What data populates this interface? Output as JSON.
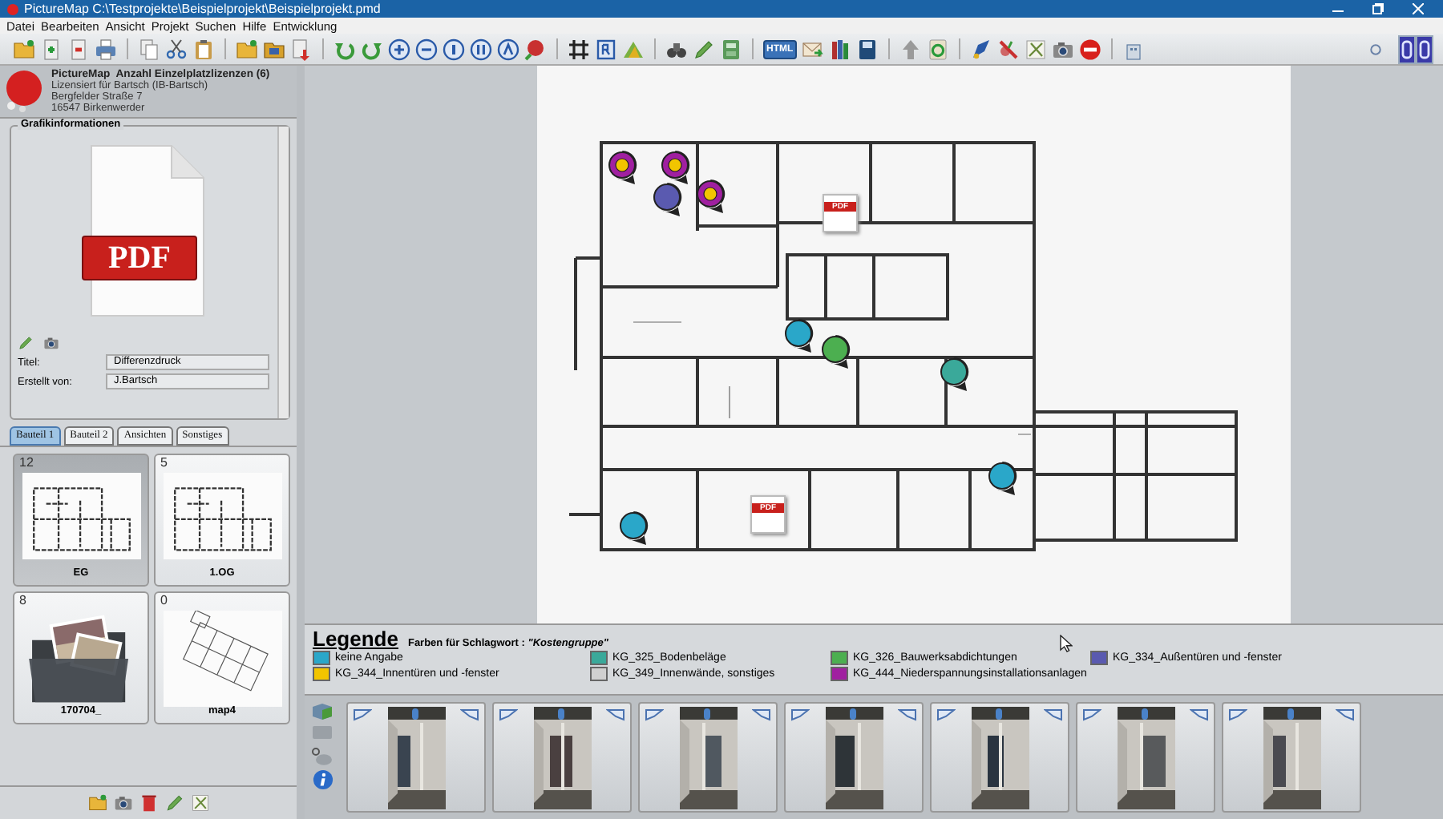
{
  "window": {
    "title": "PictureMap  C:\\Testprojekte\\Beispielprojekt\\Beispielprojekt.pmd"
  },
  "menu": [
    {
      "label": "Datei"
    },
    {
      "label": "Bearbeiten"
    },
    {
      "label": "Ansicht"
    },
    {
      "label": "Projekt"
    },
    {
      "label": "Suchen"
    },
    {
      "label": "Hilfe"
    },
    {
      "label": "Entwicklung"
    }
  ],
  "toolbar": {
    "html_button": "HTML"
  },
  "license": {
    "app": "PictureMap",
    "count": "Anzahl Einzelplatzlizenzen (6)",
    "lines": [
      "Lizensiert für Bartsch (IB-Bartsch)",
      "Bergfelder Straße  7",
      "16547  Birkenwerder"
    ]
  },
  "graphic_info": {
    "title": "Grafikinformationen",
    "document_label": "PDF",
    "fields": [
      {
        "label": "Titel:",
        "value": "Differenzdruck"
      },
      {
        "label": "Erstellt von:",
        "value": "J.Bartsch"
      }
    ]
  },
  "tabs": [
    {
      "label": "Bauteil 1",
      "selected": true
    },
    {
      "label": "Bauteil 2",
      "selected": false
    },
    {
      "label": "Ansichten",
      "selected": false
    },
    {
      "label": "Sonstiges",
      "selected": false
    }
  ],
  "plans": [
    {
      "count": "12",
      "name": "EG",
      "kind": "plan",
      "selected": true
    },
    {
      "count": "5",
      "name": "1.OG",
      "kind": "plan",
      "selected": false
    },
    {
      "count": "8",
      "name": "170704_",
      "kind": "folder",
      "selected": false
    },
    {
      "count": "0",
      "name": "map4",
      "kind": "map",
      "selected": false
    }
  ],
  "floor_plan": {
    "documents": [
      {
        "label": "PDF"
      },
      {
        "label": "PDF"
      }
    ],
    "markers": [
      {
        "color": "#a020a0",
        "center": {
          "color": "#f2c500"
        }
      },
      {
        "color": "#a020a0",
        "center": {
          "color": "#f2c500"
        }
      },
      {
        "color": "#5a5ab0"
      },
      {
        "color": "#a020a0",
        "center": {
          "color": "#f2c500"
        }
      },
      {
        "color": "#2aa7c9"
      },
      {
        "color": "#4caf50"
      },
      {
        "color": "#3aa99a"
      },
      {
        "color": "#2aa7c9"
      },
      {
        "color": "#2aa7c9"
      }
    ]
  },
  "legend": {
    "title": "Legende",
    "subtitle": "Farben für Schlagwort : *\"Kostengruppe\"*",
    "items": [
      {
        "label": "keine Angabe",
        "color": "#2aa7c9"
      },
      {
        "label": "KG_325_Bodenbeläge",
        "color": "#3aa99a"
      },
      {
        "label": "KG_326_Bauwerksabdichtungen",
        "color": "#4caf50"
      },
      {
        "label": "KG_334_Außentüren und -fenster",
        "color": "#5a5ab0"
      },
      {
        "label": "KG_344_Innentüren und -fenster",
        "color": "#f2c500"
      },
      {
        "label": "KG_349_Innenwände, sonstiges",
        "color": "#d0d0d0"
      },
      {
        "label": "KG_444_Niederspannungsinstallationsanlagen",
        "color": "#a020a0"
      }
    ]
  }
}
